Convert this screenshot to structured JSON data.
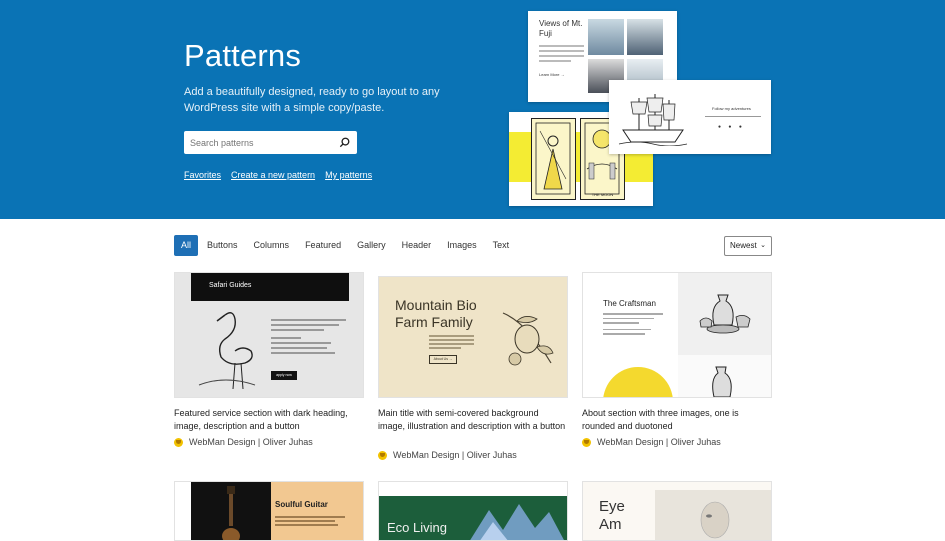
{
  "hero": {
    "title": "Patterns",
    "subtitle": "Add a beautifully designed, ready to go layout to any WordPress site with a simple copy/paste.",
    "search_placeholder": "Search patterns",
    "links": [
      "Favorites",
      "Create a new pattern",
      "My patterns"
    ],
    "bg_color": "#0a73b5",
    "previews": {
      "fuji_title": "Views of Mt. Fuji",
      "fuji_more": "Learn More →",
      "follow_text": "Follow my adventures",
      "tarot_label": "THE MOON"
    }
  },
  "filters": {
    "items": [
      "All",
      "Buttons",
      "Columns",
      "Featured",
      "Gallery",
      "Header",
      "Images",
      "Text"
    ],
    "active": "All",
    "sort_label": "Newest"
  },
  "patterns": [
    {
      "title": "Featured service section with dark heading, image, description and a button",
      "author": "WebMan Design | Oliver Juhas",
      "thumb_heading": "Safari Guides",
      "thumb_button": "apply now"
    },
    {
      "title": "Main title with semi-covered background image, illustration and description with a button",
      "author": "WebMan Design | Oliver Juhas",
      "thumb_heading": "Mountain Bio Farm Family",
      "thumb_button": "About Us →"
    },
    {
      "title": "About section with three images, one is rounded and duotoned",
      "author": "WebMan Design | Oliver Juhas",
      "thumb_heading": "The Craftsman"
    },
    {
      "thumb_heading": "Soulful Guitar"
    },
    {
      "thumb_heading": "Eco Living"
    },
    {
      "thumb_heading": "Eye Am"
    }
  ]
}
